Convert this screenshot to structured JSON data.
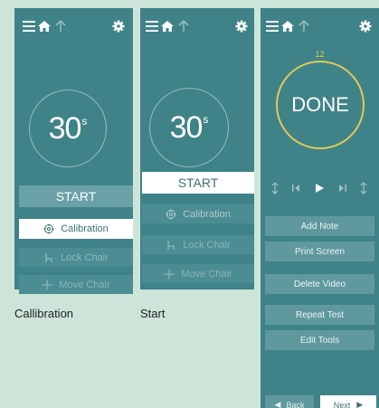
{
  "panels": [
    {
      "timer": {
        "value": "30",
        "unit": "s"
      },
      "buttons": {
        "start": "START",
        "calibration": "Calibration",
        "lock_chair": "Lock Chair",
        "reset_chair": "Move Chair"
      }
    },
    {
      "timer": {
        "value": "30",
        "unit": "s"
      },
      "buttons": {
        "start": "START",
        "calibration": "Calibration",
        "lock_chair": "Lock Chair",
        "reset_chair": "Move Chair"
      }
    },
    {
      "counter": "12",
      "status": "DONE",
      "buttons": {
        "add_note": "Add Note",
        "print_screen": "Print Screen",
        "delete_video": "Delete Video",
        "repeat_test": "Repeat Test",
        "edit_tools": "Edit Tools",
        "back": "Back",
        "next": "Next"
      }
    }
  ],
  "captions": {
    "first": "Callibration",
    "second": "Start"
  },
  "colors": {
    "panel": "#3f8388",
    "background": "#cde5d9",
    "done_ring": "#e0c95c",
    "button": "#6aa1a6"
  },
  "icons": [
    "menu-icon",
    "home-icon",
    "up-arrow-icon",
    "gear-icon",
    "crosshair-icon",
    "chair-icon",
    "move-icon",
    "play-icon",
    "step-back-icon",
    "step-forward-icon",
    "back-arrow-icon",
    "next-arrow-icon"
  ]
}
